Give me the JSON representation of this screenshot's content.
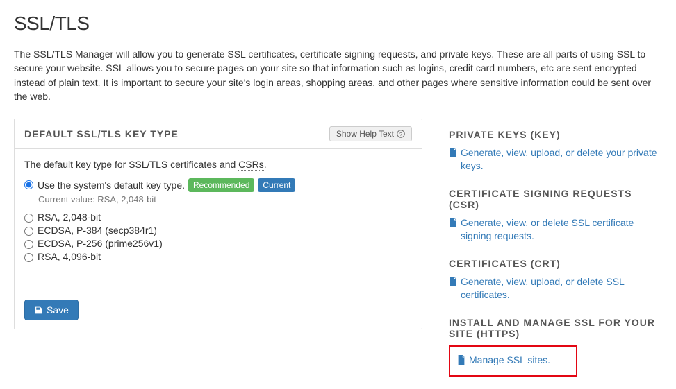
{
  "page_title": "SSL/TLS",
  "intro": "The SSL/TLS Manager will allow you to generate SSL certificates, certificate signing requests, and private keys. These are all parts of using SSL to secure your website. SSL allows you to secure pages on your site so that information such as logins, credit card numbers, etc are sent encrypted instead of plain text. It is important to secure your site's login areas, shopping areas, and other pages where sensitive information could be sent over the web.",
  "panel": {
    "title": "DEFAULT SSL/TLS KEY TYPE",
    "help_btn": "Show Help Text",
    "desc_prefix": "The default key type for SSL/TLS certificates and ",
    "desc_dotted": "CSRs",
    "desc_suffix": ".",
    "options": [
      {
        "label": "Use the system's default key type.",
        "selected": true,
        "recommended": "Recommended",
        "current": "Current",
        "current_value": "Current value: RSA, 2,048-bit"
      },
      {
        "label": "RSA, 2,048-bit",
        "selected": false
      },
      {
        "label": "ECDSA, P-384 (secp384r1)",
        "selected": false
      },
      {
        "label": "ECDSA, P-256 (prime256v1)",
        "selected": false
      },
      {
        "label": "RSA, 4,096-bit",
        "selected": false
      }
    ],
    "save": "Save"
  },
  "sidebar": {
    "keys": {
      "title": "PRIVATE KEYS (KEY)",
      "link": "Generate, view, upload, or delete your private keys."
    },
    "csr": {
      "title": "CERTIFICATE SIGNING REQUESTS (CSR)",
      "link": "Generate, view, or delete SSL certificate signing requests."
    },
    "crt": {
      "title": "CERTIFICATES (CRT)",
      "link": "Generate, view, upload, or delete SSL certificates."
    },
    "install": {
      "title": "INSTALL AND MANAGE SSL FOR YOUR SITE (HTTPS)",
      "link": "Manage SSL sites."
    }
  }
}
